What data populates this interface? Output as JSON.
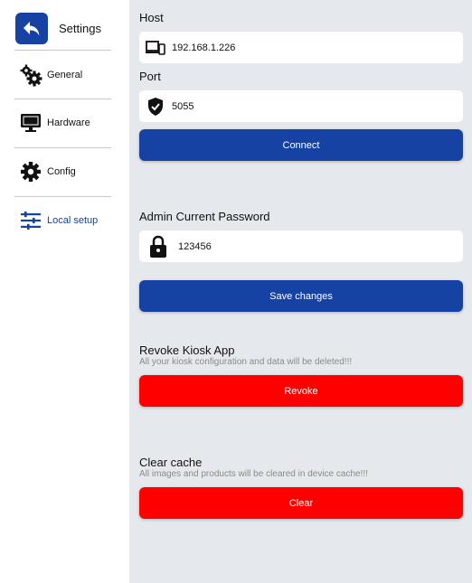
{
  "sidebar": {
    "title": "Settings",
    "items": [
      {
        "label": "General",
        "icon": "gears-icon",
        "active": false
      },
      {
        "label": "Hardware",
        "icon": "monitor-icon",
        "active": false
      },
      {
        "label": "Config",
        "icon": "gear-icon",
        "active": false
      },
      {
        "label": "Local setup",
        "icon": "sliders-icon",
        "active": true
      }
    ]
  },
  "main": {
    "host": {
      "label": "Host",
      "value": "192.168.1.226"
    },
    "port": {
      "label": "Port",
      "value": "5055"
    },
    "connect_label": "Connect",
    "admin_password": {
      "label": "Admin Current Password",
      "value": "123456"
    },
    "save_label": "Save changes",
    "revoke": {
      "title": "Revoke Kiosk App",
      "subtitle": "All your kiosk configuration and data will be deleted!!!",
      "button": "Revoke"
    },
    "clear": {
      "title": "Clear cache",
      "subtitle": "All images and products will be cleared in device cache!!!",
      "button": "Clear"
    }
  },
  "colors": {
    "accent": "#1643a3",
    "danger": "#ff0000",
    "background": "#e5e8ec"
  }
}
